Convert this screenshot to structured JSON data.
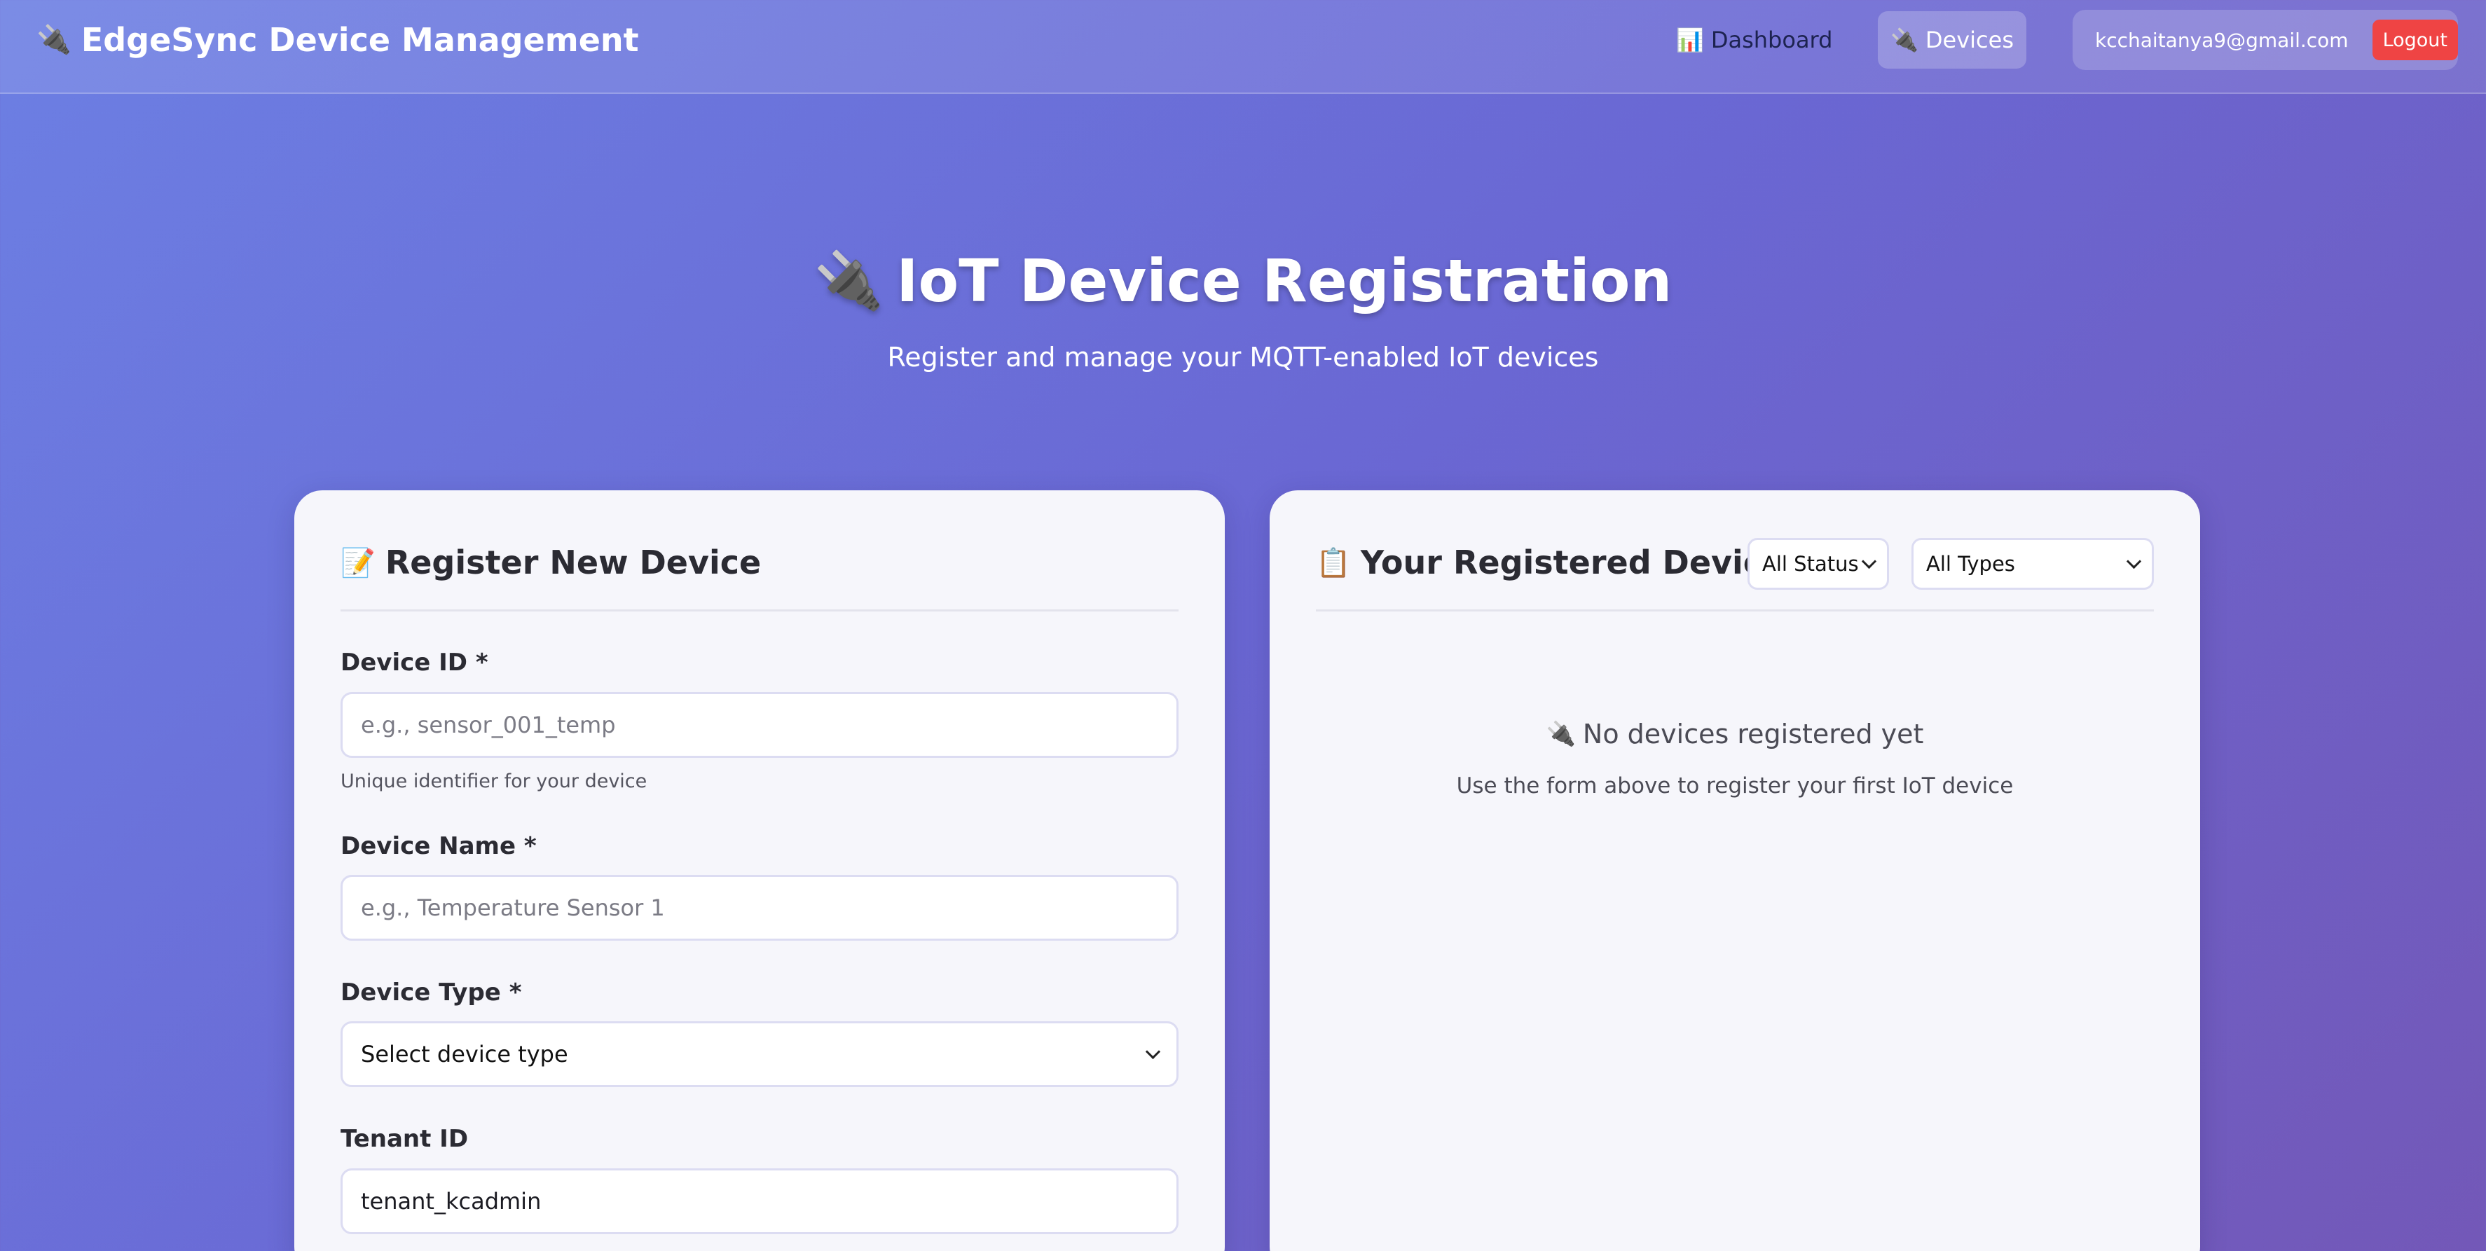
{
  "header": {
    "brand": "EdgeSync Device Management",
    "nav": {
      "dashboard": "Dashboard",
      "devices": "Devices"
    },
    "user_email": "kcchaitanya9@gmail.com",
    "logout_label": "Logout"
  },
  "hero": {
    "title": "IoT Device Registration",
    "subtitle": "Register and manage your MQTT-enabled IoT devices"
  },
  "register_form": {
    "title": "Register New Device",
    "device_id": {
      "label": "Device ID *",
      "placeholder": "e.g., sensor_001_temp",
      "value": "",
      "hint": "Unique identifier for your device"
    },
    "device_name": {
      "label": "Device Name *",
      "placeholder": "e.g., Temperature Sensor 1",
      "value": ""
    },
    "device_type": {
      "label": "Device Type *",
      "selected": "Select device type"
    },
    "tenant_id": {
      "label": "Tenant ID",
      "value": "tenant_kcadmin"
    }
  },
  "devices_panel": {
    "title": "Your Registered Devices",
    "status_filter": "All Status",
    "type_filter": "All Types",
    "empty_title": "No devices registered yet",
    "empty_subtitle": "Use the form above to register your first IoT device"
  },
  "colors": {
    "gradient_start": "#6c7fe3",
    "gradient_end": "#7358b8",
    "logout": "#ef4444",
    "card_bg": "#f6f6fb"
  },
  "icons": {
    "brand": "plug-icon",
    "dashboard": "bar-chart-icon",
    "devices": "plug-icon",
    "register": "memo-icon",
    "devices_list": "clipboard-icon",
    "select": "chevron-down-icon"
  }
}
